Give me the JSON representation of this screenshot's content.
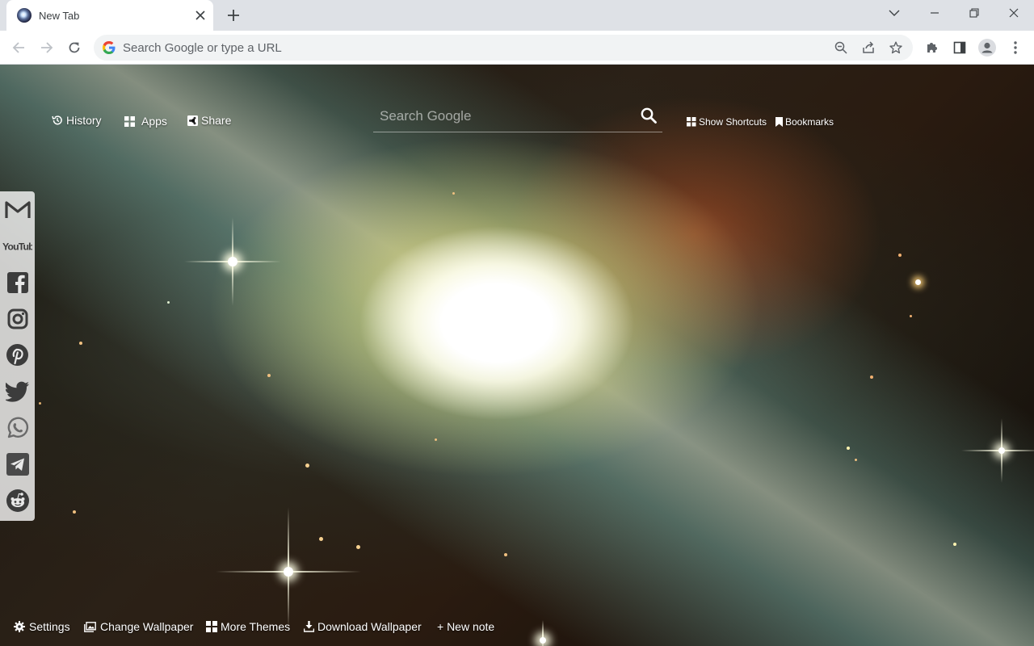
{
  "browser": {
    "tab_title": "New Tab",
    "omnibox_placeholder": "Search Google or type a URL"
  },
  "newtab": {
    "top_links": {
      "history": "History",
      "apps": "Apps",
      "share": "Share"
    },
    "search": {
      "placeholder": "Search Google"
    },
    "right_links": {
      "shortcuts": "Show Shortcuts",
      "bookmarks": "Bookmarks"
    },
    "social_icons": [
      "gmail-icon",
      "youtube-icon",
      "facebook-icon",
      "instagram-icon",
      "pinterest-icon",
      "twitter-icon",
      "whatsapp-icon",
      "telegram-icon",
      "reddit-icon"
    ],
    "youtube_text": "YouTube",
    "bottom_links": {
      "settings": "Settings",
      "change_wallpaper": "Change Wallpaper",
      "more_themes": "More Themes",
      "download_wallpaper": "Download Wallpaper",
      "new_note": "+ New note"
    }
  },
  "colors": {
    "tabstrip": "#dee1e6",
    "toolbar": "#ffffff",
    "omnibox": "#f1f3f4",
    "icon": "#5f6368",
    "sidebar_bg": "#ffffffc7",
    "sidebar_icon": "#3c3c3c"
  }
}
